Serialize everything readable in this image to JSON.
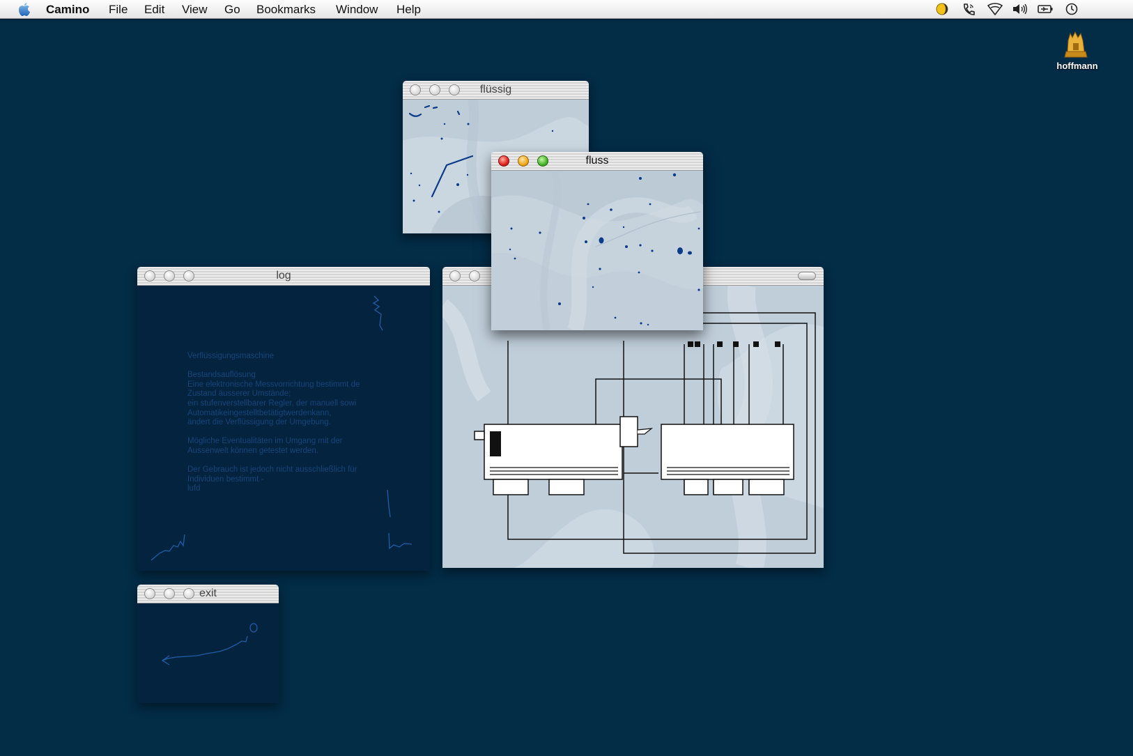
{
  "menubar": {
    "app_name": "Camino",
    "items": [
      "File",
      "Edit",
      "View",
      "Go",
      "Bookmarks",
      "Window",
      "Help"
    ],
    "status_icons": [
      "moon-clock-icon",
      "phone-icon",
      "airport-wifi-icon",
      "volume-icon",
      "battery-icon",
      "clock-icon"
    ]
  },
  "desktop": {
    "drive_icon": "drive-icon",
    "drive_label": "hoffmann"
  },
  "windows": {
    "fluessig": {
      "title": "flüssig"
    },
    "fluss": {
      "title": "fluss"
    },
    "log": {
      "title": "log",
      "text": "Verflüssigungsmaschine\n\nBestandsauflösung\nEine elektronische Messvorrichtung bestimmt de\nZustand äusserer Umstände;\nein stufenverstellbarer Regler, der manuell sowi\nAutomatikeingestelltbetätigtwerdenkann,\nändert die Verflüssigung der Umgebung.\n\nMögliche Eventualitäten im Umgang mit der\nAussenwelt können getestet werden.\n\nDer Gebrauch ist jedoch nicht ausschließlich für\nIndividuen bestimmt -\nlufd"
    },
    "machine": {
      "title": ""
    },
    "exit": {
      "title": "exit"
    }
  },
  "colors": {
    "desktop": "#032c47",
    "dark_pane": "#04233f",
    "light_pane": "#c6d3dd",
    "ink": "#0c3a8a"
  }
}
